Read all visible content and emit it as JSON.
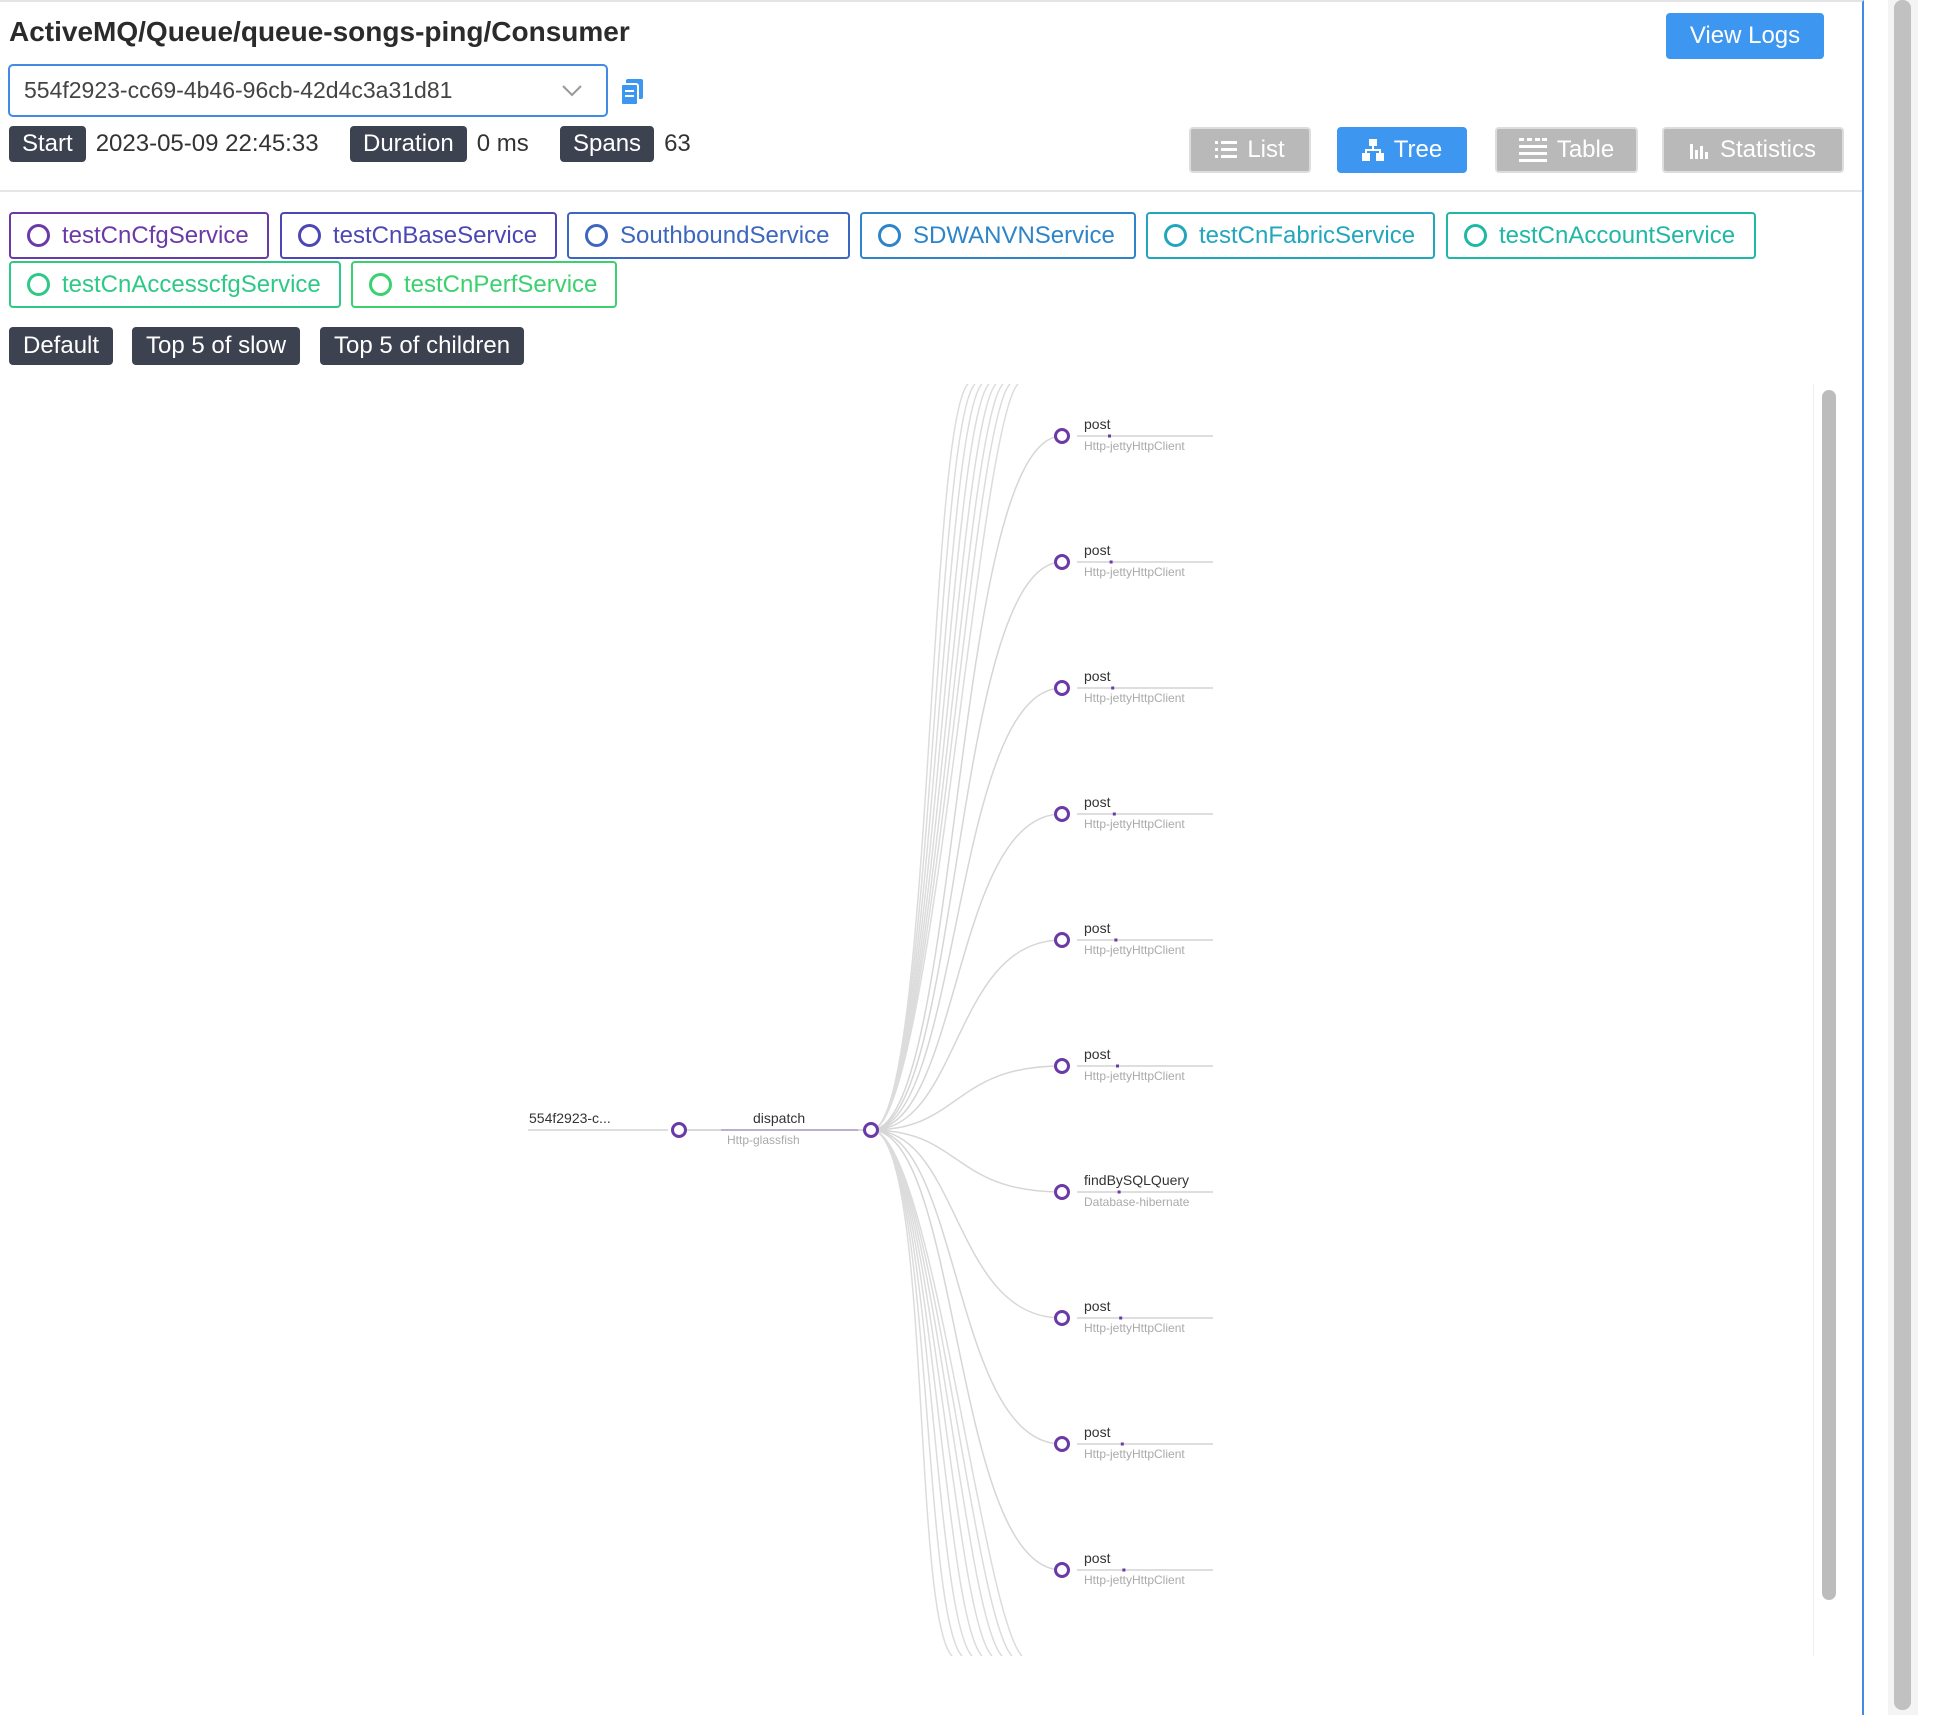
{
  "header": {
    "title": "ActiveMQ/Queue/queue-songs-ping/Consumer",
    "view_logs": "View Logs",
    "trace_id": "554f2923-cc69-4b46-96cb-42d4c3a31d81"
  },
  "meta": {
    "start_label": "Start",
    "start_value": "2023-05-09 22:45:33",
    "duration_label": "Duration",
    "duration_value": "0 ms",
    "spans_label": "Spans",
    "spans_value": "63"
  },
  "views": {
    "list": "List",
    "tree": "Tree",
    "table": "Table",
    "statistics": "Statistics",
    "active": "Tree"
  },
  "services": [
    {
      "name": "testCnCfgService",
      "color": "#6a3aa6"
    },
    {
      "name": "testCnBaseService",
      "color": "#4d47b5"
    },
    {
      "name": "SouthboundService",
      "color": "#3c66c0"
    },
    {
      "name": "SDWANVNService",
      "color": "#2d84c8"
    },
    {
      "name": "testCnFabricService",
      "color": "#21a6bd"
    },
    {
      "name": "testCnAccountService",
      "color": "#1fb8a5"
    },
    {
      "name": "testCnAccesscfgService",
      "color": "#2ec987"
    },
    {
      "name": "testCnPerfService",
      "color": "#3ad16f"
    }
  ],
  "sort": {
    "default": "Default",
    "slow": "Top 5 of slow",
    "children": "Top 5 of children"
  },
  "tree": {
    "root": {
      "label": "554f2923-c...",
      "sub": ""
    },
    "dispatch": {
      "label": "dispatch",
      "sub": "Http-glassfish"
    },
    "children": [
      {
        "label": "post",
        "sub": "Http-jettyHttpClient"
      },
      {
        "label": "post",
        "sub": "Http-jettyHttpClient"
      },
      {
        "label": "post",
        "sub": "Http-jettyHttpClient"
      },
      {
        "label": "post",
        "sub": "Http-jettyHttpClient"
      },
      {
        "label": "post",
        "sub": "Http-jettyHttpClient"
      },
      {
        "label": "post",
        "sub": "Http-jettyHttpClient"
      },
      {
        "label": "findBySQLQuery",
        "sub": "Database-hibernate"
      },
      {
        "label": "post",
        "sub": "Http-jettyHttpClient"
      },
      {
        "label": "post",
        "sub": "Http-jettyHttpClient"
      },
      {
        "label": "post",
        "sub": "Http-jettyHttpClient"
      }
    ],
    "node_color": "#6a3aa6"
  }
}
